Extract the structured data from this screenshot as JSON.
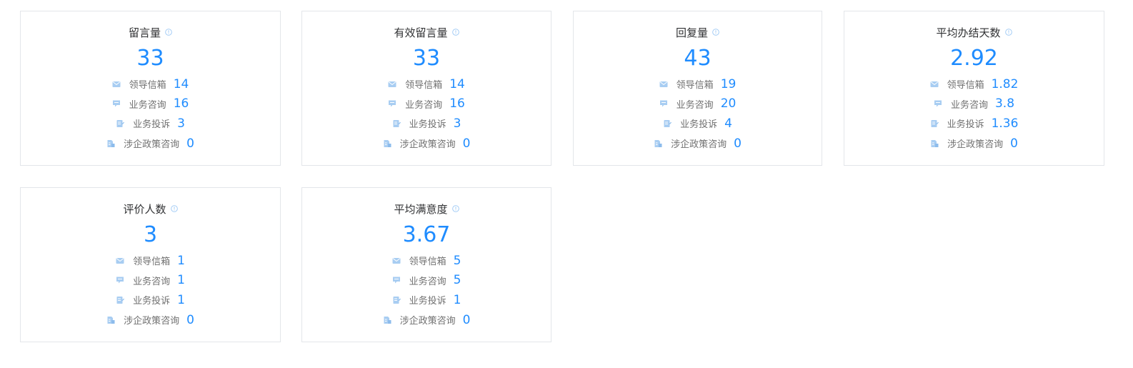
{
  "cards": [
    {
      "title": "留言量",
      "value": "33",
      "items": [
        {
          "icon": "mail-icon",
          "label": "领导信箱",
          "value": "14"
        },
        {
          "icon": "chat-bubble-icon",
          "label": "业务咨询",
          "value": "16"
        },
        {
          "icon": "document-edit-icon",
          "label": "业务投诉",
          "value": "3"
        },
        {
          "icon": "building-icon",
          "label": "涉企政策咨询",
          "value": "0"
        }
      ]
    },
    {
      "title": "有效留言量",
      "value": "33",
      "items": [
        {
          "icon": "mail-icon",
          "label": "领导信箱",
          "value": "14"
        },
        {
          "icon": "chat-bubble-icon",
          "label": "业务咨询",
          "value": "16"
        },
        {
          "icon": "document-edit-icon",
          "label": "业务投诉",
          "value": "3"
        },
        {
          "icon": "building-icon",
          "label": "涉企政策咨询",
          "value": "0"
        }
      ]
    },
    {
      "title": "回复量",
      "value": "43",
      "items": [
        {
          "icon": "mail-icon",
          "label": "领导信箱",
          "value": "19"
        },
        {
          "icon": "chat-bubble-icon",
          "label": "业务咨询",
          "value": "20"
        },
        {
          "icon": "document-edit-icon",
          "label": "业务投诉",
          "value": "4"
        },
        {
          "icon": "building-icon",
          "label": "涉企政策咨询",
          "value": "0"
        }
      ]
    },
    {
      "title": "平均办结天数",
      "value": "2.92",
      "items": [
        {
          "icon": "mail-icon",
          "label": "领导信箱",
          "value": "1.82"
        },
        {
          "icon": "chat-bubble-icon",
          "label": "业务咨询",
          "value": "3.8"
        },
        {
          "icon": "document-edit-icon",
          "label": "业务投诉",
          "value": "1.36"
        },
        {
          "icon": "building-icon",
          "label": "涉企政策咨询",
          "value": "0"
        }
      ]
    },
    {
      "title": "评价人数",
      "value": "3",
      "items": [
        {
          "icon": "mail-icon",
          "label": "领导信箱",
          "value": "1"
        },
        {
          "icon": "chat-bubble-icon",
          "label": "业务咨询",
          "value": "1"
        },
        {
          "icon": "document-edit-icon",
          "label": "业务投诉",
          "value": "1"
        },
        {
          "icon": "building-icon",
          "label": "涉企政策咨询",
          "value": "0"
        }
      ]
    },
    {
      "title": "平均满意度",
      "value": "3.67",
      "items": [
        {
          "icon": "mail-icon",
          "label": "领导信箱",
          "value": "5"
        },
        {
          "icon": "chat-bubble-icon",
          "label": "业务咨询",
          "value": "5"
        },
        {
          "icon": "document-edit-icon",
          "label": "业务投诉",
          "value": "1"
        },
        {
          "icon": "building-icon",
          "label": "涉企政策咨询",
          "value": "0"
        }
      ]
    }
  ],
  "colors": {
    "accent": "#1f8cff",
    "icon": "#a8cdf2",
    "info": "#9cc8f5",
    "title": "#303133",
    "label": "#707070",
    "border": "#e3e6ea"
  }
}
